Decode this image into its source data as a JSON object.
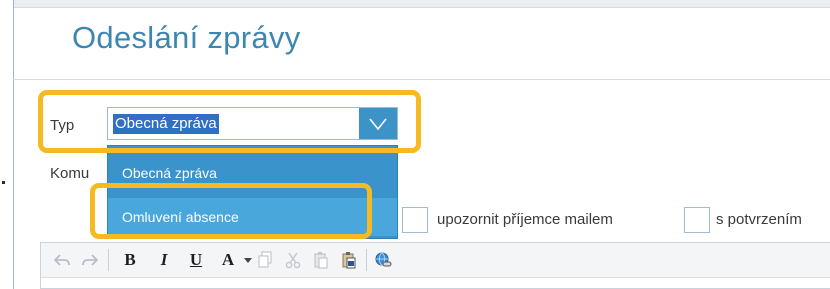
{
  "page": {
    "title": "Odeslání zprávy"
  },
  "form": {
    "typ_label": "Typ",
    "typ_value": "Obecná zpráva",
    "komu_label": "Komu",
    "dropdown_options": [
      "Obecná zpráva",
      "Omluvení absence"
    ],
    "checkbox_notify_label": "upozornit příjemce mailem",
    "checkbox_confirm_label": "s potvrzením"
  },
  "toolbar": {
    "bold": "B",
    "italic": "I",
    "underline": "U",
    "font_color": "A"
  },
  "colors": {
    "title": "#3d86b1",
    "accent": "#3c93c8",
    "highlight": "#f5b921",
    "selection": "#2f6fc4"
  },
  "icons": [
    "undo-icon",
    "redo-icon",
    "chevron-down-icon",
    "copy-icon",
    "cut-icon",
    "paste-icon",
    "paste-word-icon",
    "link-icon"
  ]
}
